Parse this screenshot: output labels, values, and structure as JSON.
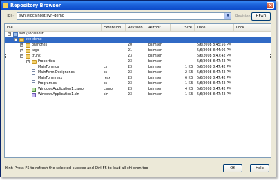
{
  "window": {
    "title": "Repository Browser"
  },
  "toolbar": {
    "url_label": "URL:",
    "url_value": "svn://localhost/svn-demo",
    "revision_label": "Revision:",
    "revision_button": "HEAD"
  },
  "columns": [
    "File",
    "Extension",
    "Revision",
    "Author",
    "Size",
    "Date",
    "Lock"
  ],
  "rows": [
    {
      "name": "svn://localhost",
      "ext": "",
      "rev": "",
      "author": "",
      "size": "",
      "date": "",
      "lock": "",
      "icon": "repository-icon",
      "expander": "-"
    },
    {
      "name": "svn-demo",
      "ext": "",
      "rev": "",
      "author": "",
      "size": "",
      "date": "",
      "lock": "",
      "icon": "folder-icon",
      "expander": "-"
    },
    {
      "name": "branches",
      "ext": "",
      "rev": "20",
      "author": "bsimser",
      "size": "",
      "date": "5/6/2008 8:45:56 PM",
      "lock": "",
      "icon": "folder-icon",
      "expander": "+"
    },
    {
      "name": "tags",
      "ext": "",
      "rev": "21",
      "author": "bsimser",
      "size": "",
      "date": "5/6/2008 8:44:06 PM",
      "lock": "",
      "icon": "folder-icon",
      "expander": "+"
    },
    {
      "name": "trunk",
      "ext": "",
      "rev": "23",
      "author": "bsimser",
      "size": "",
      "date": "5/6/2008 8:47:42 PM",
      "lock": "",
      "icon": "folder-icon",
      "expander": "-"
    },
    {
      "name": "Properties",
      "ext": "",
      "rev": "23",
      "author": "bsimser",
      "size": "",
      "date": "5/6/2008 8:47:42 PM",
      "lock": "",
      "icon": "folder-icon",
      "expander": "+"
    },
    {
      "name": "MainForm.cs",
      "ext": "cs",
      "rev": "23",
      "author": "bsimser",
      "size": "1 KB",
      "date": "5/6/2008 8:47:42 PM",
      "lock": "",
      "icon": "cs-file-icon",
      "expander": ""
    },
    {
      "name": "MainForm.Designer.cs",
      "ext": "cs",
      "rev": "23",
      "author": "bsimser",
      "size": "2 KB",
      "date": "5/6/2008 8:47:42 PM",
      "lock": "",
      "icon": "cs-file-icon",
      "expander": ""
    },
    {
      "name": "MainForm.resx",
      "ext": "resx",
      "rev": "23",
      "author": "bsimser",
      "size": "6 KB",
      "date": "5/6/2008 8:47:42 PM",
      "lock": "",
      "icon": "resx-file-icon",
      "expander": ""
    },
    {
      "name": "Program.cs",
      "ext": "cs",
      "rev": "23",
      "author": "bsimser",
      "size": "1 KB",
      "date": "5/6/2008 8:47:42 PM",
      "lock": "",
      "icon": "cs-file-icon",
      "expander": ""
    },
    {
      "name": "WindowsApplication1.csproj",
      "ext": "csproj",
      "rev": "23",
      "author": "bsimser",
      "size": "4 KB",
      "date": "5/6/2008 8:47:42 PM",
      "lock": "",
      "icon": "csproj-icon",
      "expander": ""
    },
    {
      "name": "WindowsApplication1.sln",
      "ext": "sln",
      "rev": "23",
      "author": "bsimser",
      "size": "1 KB",
      "date": "5/6/2008 8:47:42 PM",
      "lock": "",
      "icon": "sln-icon",
      "expander": ""
    }
  ],
  "footer": {
    "hint": "Hint: Press F5 to refresh the selected subtree and Ctrl-F5 to load all children too",
    "ok_label": "OK",
    "help_label": "Help"
  },
  "colors": {
    "selection": "#316ac5",
    "titlebar": "#0b48c8"
  }
}
